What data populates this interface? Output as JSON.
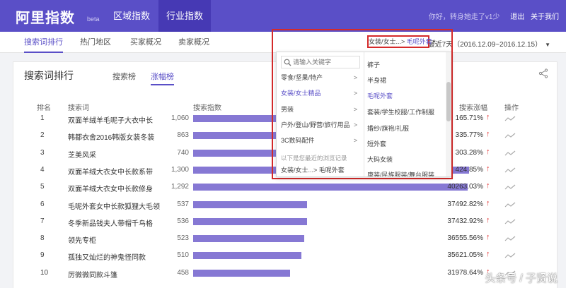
{
  "topbar": {
    "brand": "阿里指数",
    "beta": "beta",
    "tabs": [
      {
        "label": "区域指数"
      },
      {
        "label": "行业指数"
      }
    ],
    "hello": "你好，转身她走了v1少",
    "logout": "退出",
    "about": "关于我们"
  },
  "subnav": {
    "tabs": [
      {
        "label": "搜索词排行"
      },
      {
        "label": "热门地区"
      },
      {
        "label": "买家概况"
      },
      {
        "label": "卖家概况"
      }
    ],
    "range_label": "最近7天（2016.12.09~2016.12.15）"
  },
  "card": {
    "title": "搜索词排行",
    "tabs": [
      {
        "label": "搜索榜"
      },
      {
        "label": "涨幅榜"
      }
    ],
    "headers": {
      "rank": "排名",
      "keyword": "搜索词",
      "index": "搜索指数",
      "growth": "搜索涨幅",
      "action": "操作"
    },
    "rows": [
      {
        "rank": "1",
        "keyword": "双面羊绒羊毛呢子大衣中长",
        "index": "1,060",
        "index_value": 1060,
        "growth": "165.71%"
      },
      {
        "rank": "2",
        "keyword": "韩都衣舍2016韩版女装冬装",
        "index": "863",
        "index_value": 863,
        "growth": "335.77%"
      },
      {
        "rank": "3",
        "keyword": "芝美风采",
        "index": "740",
        "index_value": 740,
        "growth": "303.28%"
      },
      {
        "rank": "4",
        "keyword": "双面羊绒大衣女中长款系带",
        "index": "1,300",
        "index_value": 1300,
        "growth": "424.85%"
      },
      {
        "rank": "5",
        "keyword": "双面羊绒大衣女中长款修身",
        "index": "1,292",
        "index_value": 1292,
        "growth": "40263.03%"
      },
      {
        "rank": "6",
        "keyword": "毛呢外套女中长款狐狸大毛领",
        "index": "537",
        "index_value": 537,
        "growth": "37492.82%"
      },
      {
        "rank": "7",
        "keyword": "冬季新品钱夫人带帽千鸟格",
        "index": "536",
        "index_value": 536,
        "growth": "37432.92%"
      },
      {
        "rank": "8",
        "keyword": "领先专柜",
        "index": "523",
        "index_value": 523,
        "growth": "36555.56%"
      },
      {
        "rank": "9",
        "keyword": "孤独又灿烂的神鬼怪同款",
        "index": "510",
        "index_value": 510,
        "growth": "35621.05%"
      },
      {
        "rank": "10",
        "keyword": "厉微微同款斗篷",
        "index": "458",
        "index_value": 458,
        "growth": "31978.64%"
      }
    ],
    "index_max": 1300
  },
  "dropdown": {
    "trigger_prefix": "女装/女士...",
    "trigger_sep": ">",
    "trigger_selected": "毛呢外套",
    "search_placeholder": "请输入关键字",
    "categories": [
      {
        "label": "零食/坚果/特产",
        "arrow": ">"
      },
      {
        "label": "女装/女士精品",
        "arrow": ">"
      },
      {
        "label": "男装",
        "arrow": ">"
      },
      {
        "label": "户外/登山/野营/旅行用品",
        "arrow": ">"
      },
      {
        "label": "3C数码配件",
        "arrow": ">"
      }
    ],
    "recent_note": "以下是您最近的浏览记录",
    "recent_item": "女装/女士...> 毛呢外套",
    "subcategories": [
      {
        "label": "裤子"
      },
      {
        "label": "半身裙"
      },
      {
        "label": "毛呢外套"
      },
      {
        "label": "套装/学生校服/工作制服"
      },
      {
        "label": "婚纱/旗袍/礼服"
      },
      {
        "label": "短外套"
      },
      {
        "label": "大码女装"
      },
      {
        "label": "唐装/民族服装/舞台服装"
      }
    ]
  },
  "watermark": "头条号 / 子贤说",
  "colors": {
    "brand": "#5a4fc7",
    "bar": "#8678d4",
    "highlight": "#d42a2a",
    "up_arrow": "#e02020"
  }
}
